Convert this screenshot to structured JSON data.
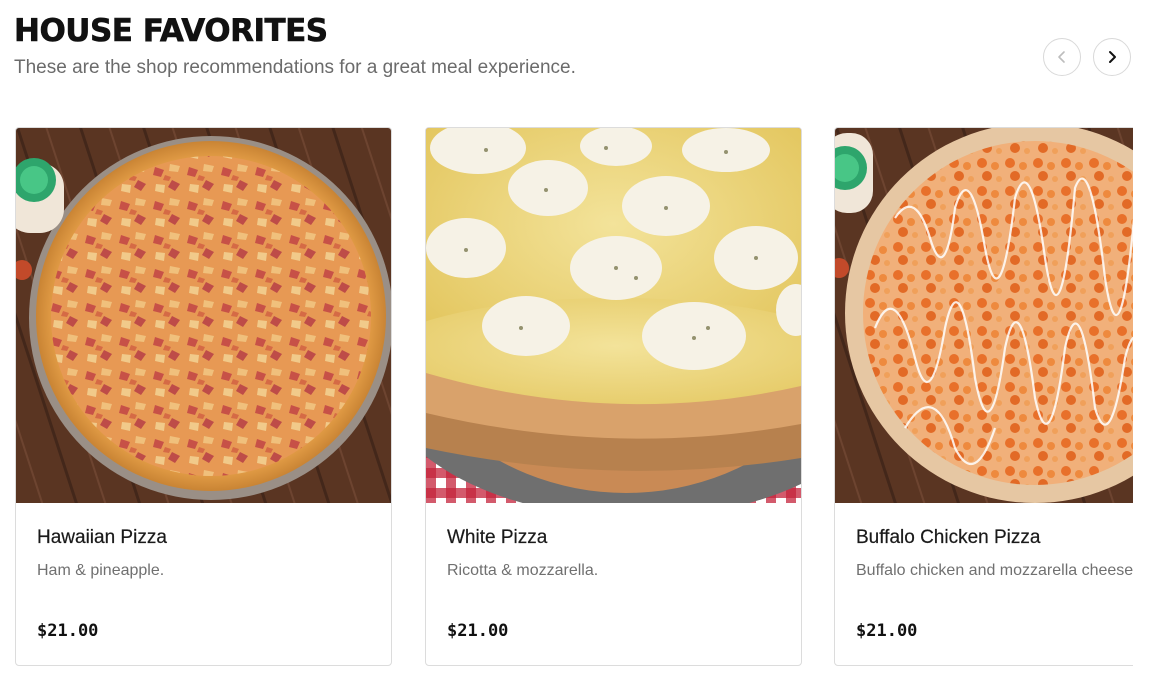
{
  "section": {
    "title": "HOUSE FAVORITES",
    "subtitle": "These are the shop recommendations for a great meal experience."
  },
  "carousel": {
    "prev_icon": "chevron-left-icon",
    "next_icon": "chevron-right-icon",
    "items": [
      {
        "name": "Hawaiian Pizza",
        "description": "Ham & pineapple.",
        "price": "$21.00",
        "image": "hawaiian-pizza-photo"
      },
      {
        "name": "White Pizza",
        "description": "Ricotta & mozzarella.",
        "price": "$21.00",
        "image": "white-pizza-photo"
      },
      {
        "name": "Buffalo Chicken Pizza",
        "description": "Buffalo chicken and mozzarella cheese.",
        "price": "$21.00",
        "image": "buffalo-chicken-pizza-photo"
      }
    ]
  },
  "colors": {
    "title": "#111111",
    "subtitle": "#6b6b6b",
    "card_border": "#dcdcdc",
    "description": "#707070"
  }
}
